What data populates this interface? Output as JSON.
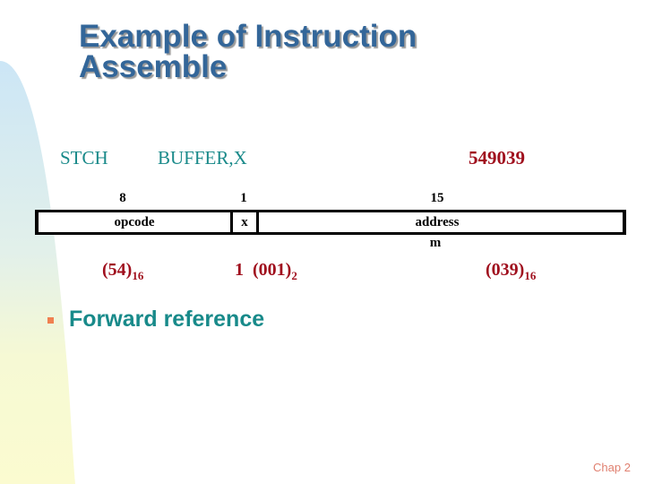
{
  "slide": {
    "title_line1": "Example of Instruction",
    "title_line2": "Assemble",
    "colors": {
      "title": "#336699",
      "instruction_text": "#1a8a8a",
      "object_code": "#a0101e",
      "bullet_marker": "#f08050",
      "bullet_text": "#188a8a",
      "footer": "#e08070"
    }
  },
  "instruction": {
    "mnemonic": "STCH",
    "operand": "BUFFER,X",
    "object_code": "549039"
  },
  "format": {
    "fields": [
      {
        "bits": "8",
        "name": "opcode",
        "value": "(54)",
        "base": "16"
      },
      {
        "bits": "1",
        "name": "x",
        "value": "1  (001)",
        "base": "2"
      },
      {
        "bits": "15",
        "name": "address",
        "sublabel": "m",
        "value": "(039)",
        "base": "16"
      }
    ]
  },
  "bullets": [
    {
      "icon": "square-bullet-icon",
      "text": "Forward reference"
    }
  ],
  "footer": {
    "text": "Chap 2"
  }
}
